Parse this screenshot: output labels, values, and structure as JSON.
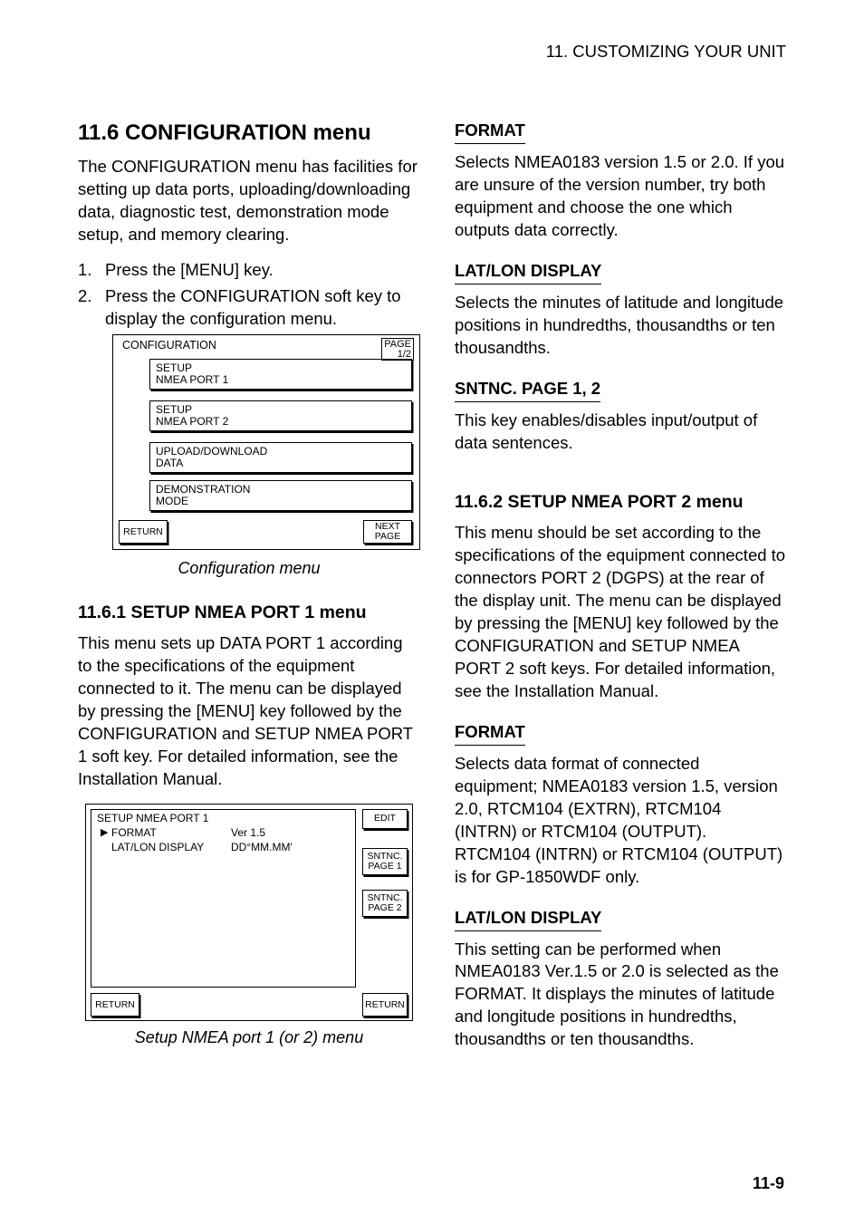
{
  "header": {
    "right": "11. CUSTOMIZING YOUR UNIT"
  },
  "left": {
    "section_title": "11.6 CONFIGURATION menu",
    "para1": "The CONFIGURATION menu has facilities for setting up data ports, uploading/downloading data, diagnostic test, demonstration mode setup, and memory clearing.",
    "step1_num": "1.",
    "step1": "Press the [MENU] key.",
    "step2_num": "2.",
    "step2": "Press the CONFIGURATION soft key to display the configuration menu.",
    "fig1_title": "CONFIGURATION",
    "fig1_page_a": "PAGE",
    "fig1_page_b": "1/2",
    "fig1_sk1a": "SETUP",
    "fig1_sk1b": "NMEA PORT 1",
    "fig1_sk2a": "SETUP",
    "fig1_sk2b": "NMEA PORT 2",
    "fig1_sk3a": "UPLOAD/DOWNLOAD",
    "fig1_sk3b": "DATA",
    "fig1_sk4a": "DEMONSTRATION",
    "fig1_sk4b": "MODE",
    "fig1_return": "RETURN",
    "fig1_next_a": "NEXT",
    "fig1_next_b": "PAGE",
    "fig1_caption": "Configuration menu",
    "sub_title": "11.6.1 SETUP NMEA PORT 1 menu",
    "sub_para": "This menu sets up DATA PORT 1 according to the specifications of the equipment connected to it. The menu can be displayed by pressing the [MENU] key followed by the CONFIGURATION and SETUP NMEA PORT 1 soft key. For detailed information, see the Installation Manual.",
    "fig2_title": "SETUP NMEA PORT 1",
    "fig2_r1a": "FORMAT",
    "fig2_r1b": "Ver 1.5",
    "fig2_r2a": "LAT/LON DISPLAY",
    "fig2_r2b": "DD°MM.MM'",
    "fig2_edit": "EDIT",
    "fig2_snt1a": "SNTNC.",
    "fig2_snt1b": "PAGE 1",
    "fig2_snt2a": "SNTNC.",
    "fig2_snt2b": "PAGE 2",
    "fig2_return": "RETURN",
    "fig2_caption": "Setup NMEA port 1 (or 2) menu"
  },
  "right": {
    "h_format": "FORMAT",
    "p_format": "Selects NMEA0183 version 1.5 or 2.0. If you are unsure of the version number, try both equipment and choose the one which outputs data correctly.",
    "h_latlon": "LAT/LON DISPLAY",
    "p_latlon": "Selects the minutes of latitude and longitude positions in hundredths, thousandths or ten thousandths.",
    "h_sntnc": "SNTNC. PAGE 1, 2",
    "p_sntnc": "This key enables/disables input/output of data sentences.",
    "h_port2": "11.6.2 SETUP NMEA PORT 2 menu",
    "p_port2": "This menu should be set according to the specifications of the equipment connected to connectors PORT 2 (DGPS) at the rear of the display unit. The menu can be displayed by pressing the [MENU] key followed by the CONFIGURATION and SETUP NMEA PORT 2 soft keys. For detailed information, see the Installation Manual.",
    "h_format2": "FORMAT",
    "p_format2": "Selects data format of connected equipment; NMEA0183 version 1.5, version 2.0, RTCM104 (EXTRN), RTCM104 (INTRN) or RTCM104 (OUTPUT). RTCM104 (INTRN) or RTCM104 (OUTPUT) is for GP-1850WDF only.",
    "h_latlon2": "LAT/LON DISPLAY",
    "p_latlon2": "This setting can be performed when NMEA0183 Ver.1.5 or 2.0 is selected as the FORMAT. It displays the minutes of latitude and longitude positions in hundredths, thousandths or ten thousandths."
  },
  "page_num": "11-9"
}
